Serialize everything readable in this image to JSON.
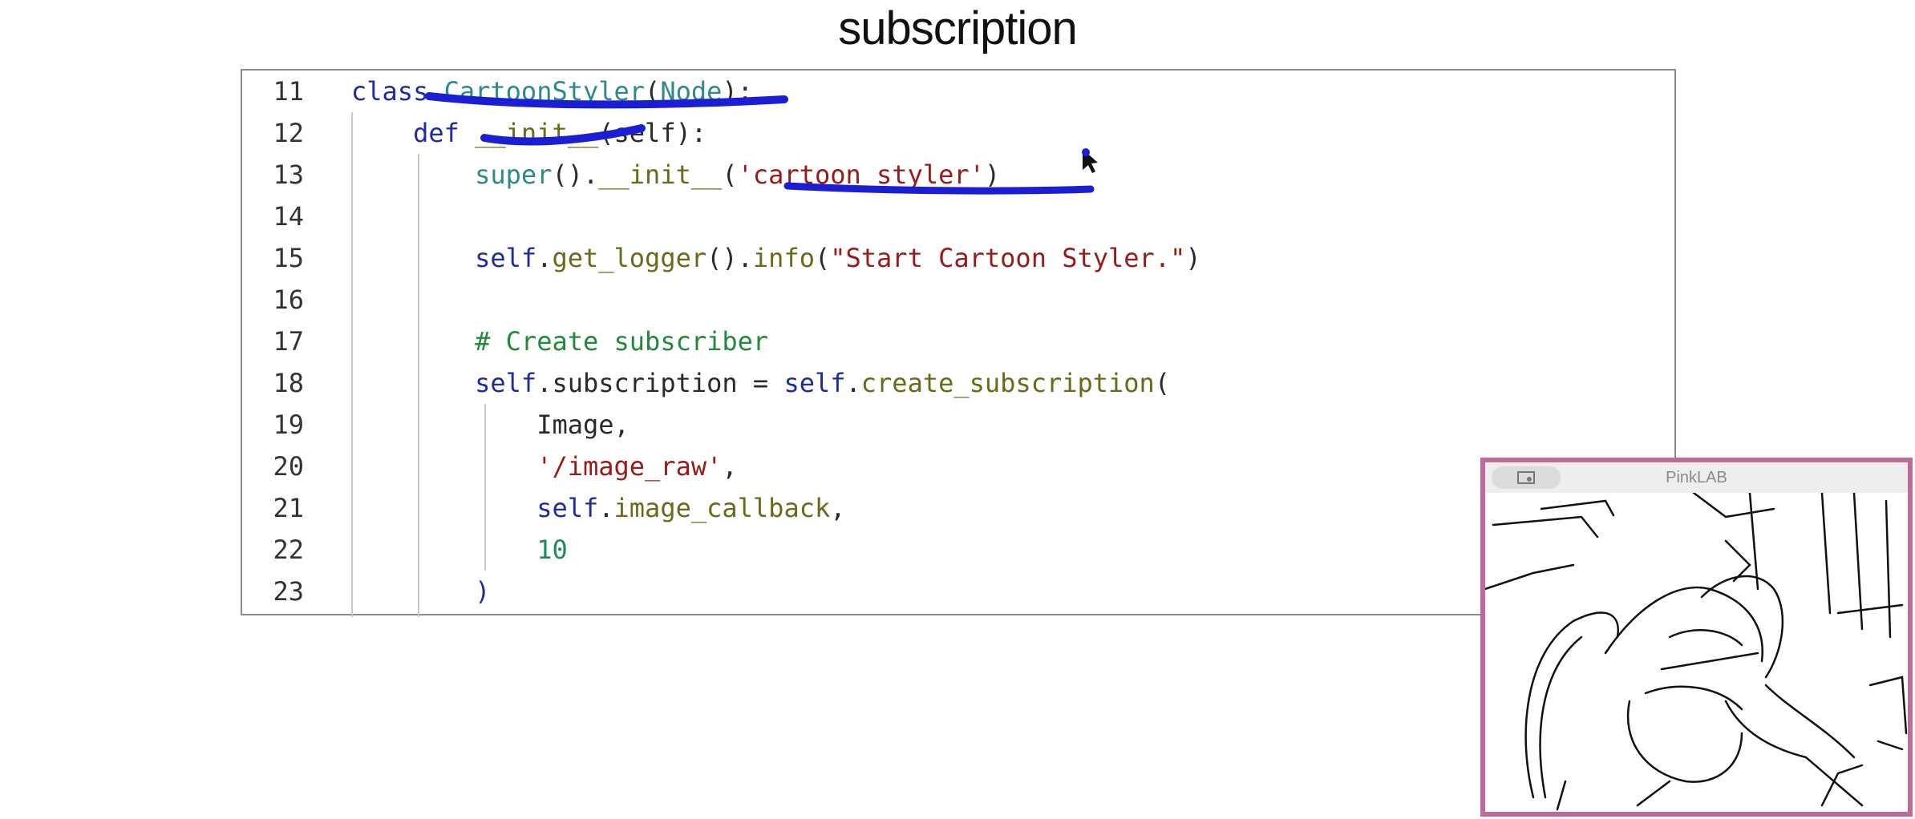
{
  "slide": {
    "title": "subscription"
  },
  "code_lines": [
    {
      "number": "11",
      "tokens": [
        {
          "t": "class ",
          "c": "kw"
        },
        {
          "t": "CartoonStyler",
          "c": "cls"
        },
        {
          "t": "(",
          "c": "attr"
        },
        {
          "t": "Node",
          "c": "cls"
        },
        {
          "t": "):",
          "c": "attr"
        }
      ]
    },
    {
      "number": "12",
      "tokens": [
        {
          "t": "    def ",
          "c": "kw"
        },
        {
          "t": "__init__",
          "c": "fn"
        },
        {
          "t": "(self):",
          "c": "attr"
        }
      ]
    },
    {
      "number": "13",
      "tokens": [
        {
          "t": "        super",
          "c": "cls"
        },
        {
          "t": "().",
          "c": "attr"
        },
        {
          "t": "__init__",
          "c": "fn"
        },
        {
          "t": "(",
          "c": "attr"
        },
        {
          "t": "'cartoon_styler'",
          "c": "str"
        },
        {
          "t": ")",
          "c": "attr"
        }
      ]
    },
    {
      "number": "14",
      "tokens": []
    },
    {
      "number": "15",
      "tokens": [
        {
          "t": "        self",
          "c": "kw"
        },
        {
          "t": ".",
          "c": "attr"
        },
        {
          "t": "get_logger",
          "c": "fn"
        },
        {
          "t": "().",
          "c": "attr"
        },
        {
          "t": "info",
          "c": "fn"
        },
        {
          "t": "(",
          "c": "attr"
        },
        {
          "t": "\"Start Cartoon Styler.\"",
          "c": "str"
        },
        {
          "t": ")",
          "c": "attr"
        }
      ]
    },
    {
      "number": "16",
      "tokens": []
    },
    {
      "number": "17",
      "tokens": [
        {
          "t": "        # Create subscriber",
          "c": "cm"
        }
      ]
    },
    {
      "number": "18",
      "tokens": [
        {
          "t": "        self",
          "c": "kw"
        },
        {
          "t": ".subscription = ",
          "c": "attr"
        },
        {
          "t": "self",
          "c": "kw"
        },
        {
          "t": ".",
          "c": "attr"
        },
        {
          "t": "create_subscription",
          "c": "fn"
        },
        {
          "t": "(",
          "c": "attr"
        }
      ]
    },
    {
      "number": "19",
      "tokens": [
        {
          "t": "            Image,",
          "c": "attr"
        }
      ]
    },
    {
      "number": "20",
      "tokens": [
        {
          "t": "            '/image_raw'",
          "c": "str"
        },
        {
          "t": ",",
          "c": "attr"
        }
      ]
    },
    {
      "number": "21",
      "tokens": [
        {
          "t": "            self",
          "c": "kw"
        },
        {
          "t": ".",
          "c": "attr"
        },
        {
          "t": "image_callback",
          "c": "fn"
        },
        {
          "t": ",",
          "c": "attr"
        }
      ]
    },
    {
      "number": "22",
      "tokens": [
        {
          "t": "            10",
          "c": "num"
        }
      ]
    },
    {
      "number": "23",
      "tokens": [
        {
          "t": "        )",
          "c": "kw"
        }
      ]
    }
  ],
  "webcam": {
    "window_title": "PinkLAB",
    "icon": "screen-share-icon"
  },
  "colors": {
    "annotation_ink": "#1a1fd6",
    "webcam_border": "#c06a9a"
  }
}
